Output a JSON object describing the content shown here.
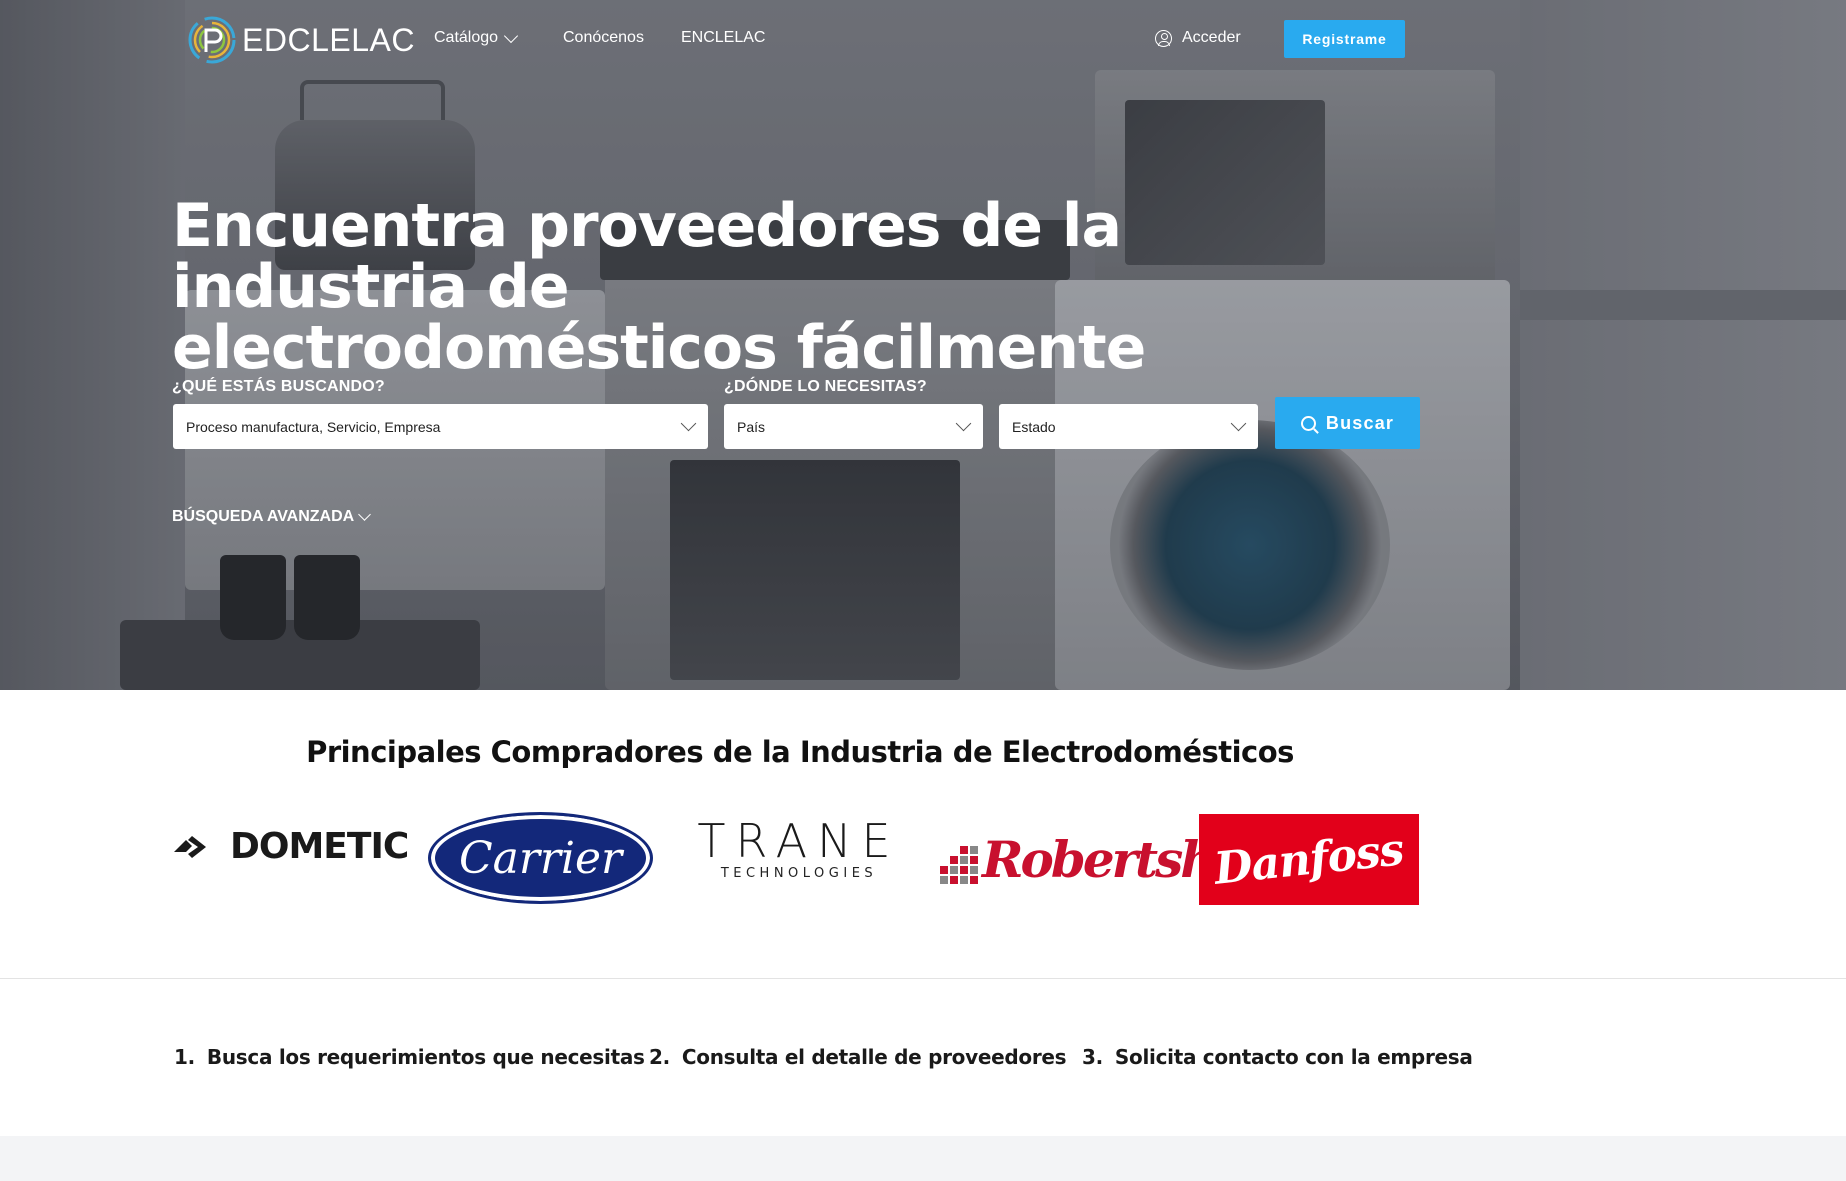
{
  "brand": {
    "name": "EDCLELAC"
  },
  "nav": {
    "catalog": "Catálogo",
    "about": "Conócenos",
    "enclelac": "ENCLELAC",
    "login": "Acceder",
    "register": "Registrame"
  },
  "hero": {
    "headline_line1": "Encuentra proveedores de la industria de",
    "headline_line2": "electrodomésticos fácilmente"
  },
  "search": {
    "what_label": "¿QUÉ ESTÁS BUSCANDO?",
    "where_label": "¿DÓNDE LO NECESITAS?",
    "what_value": "Proceso manufactura, Servicio, Empresa",
    "country_value": "País",
    "state_value": "Estado",
    "button": "Buscar",
    "advanced": "BÚSQUEDA AVANZADA"
  },
  "buyers": {
    "title": "Principales Compradores de la Industria de Electrodomésticos",
    "logos": {
      "dometic": "DOMETIC",
      "carrier": "Carrier",
      "trane_main": "TRANE",
      "trane_sub": "TECHNOLOGIES",
      "robertshaw": "Robertshaw",
      "danfoss": "Danfoss"
    }
  },
  "steps": [
    {
      "num": "1.",
      "text": "Busca los requerimientos que necesitas"
    },
    {
      "num": "2.",
      "text": "Consulta el detalle de proveedores"
    },
    {
      "num": "3.",
      "text": "Solicita contacto con la empresa"
    }
  ],
  "colors": {
    "accent": "#29aaef",
    "carrier_blue": "#13287a",
    "robertshaw_red": "#c8102e",
    "danfoss_red": "#e2001a"
  }
}
